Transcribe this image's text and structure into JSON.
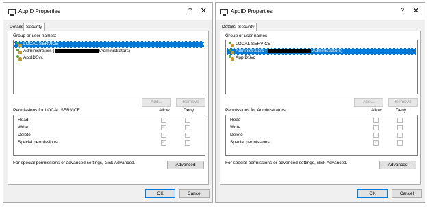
{
  "dialogs": [
    {
      "title": "AppID Properties",
      "help": "?",
      "close": "✕",
      "tabs": {
        "details": "Details",
        "security": "Security"
      },
      "group_label": "Group or user names:",
      "users": [
        {
          "label": "LOCAL SERVICE",
          "selected": true
        },
        {
          "label_prefix": "Administrators (",
          "label_suffix": "\\Administrators)",
          "selected": false
        },
        {
          "label": "AppIDSvc",
          "selected": false
        }
      ],
      "add_label": "Add...",
      "remove_label": "Remove",
      "permissions_for": "Permissions for LOCAL SERVICE",
      "allow_header": "Allow",
      "deny_header": "Deny",
      "permissions": [
        {
          "name": "Read",
          "allow": true,
          "deny": false
        },
        {
          "name": "Write",
          "allow": true,
          "deny": false
        },
        {
          "name": "Delete",
          "allow": true,
          "deny": false
        },
        {
          "name": "Special permissions",
          "allow": true,
          "deny": false
        }
      ],
      "advanced_text": "For special permissions or advanced settings, click Advanced.",
      "advanced_label": "Advanced",
      "ok_label": "OK",
      "cancel_label": "Cancel"
    },
    {
      "title": "AppID Properties",
      "help": "?",
      "close": "✕",
      "tabs": {
        "details": "Details",
        "security": "Security"
      },
      "group_label": "Group or user names:",
      "users": [
        {
          "label": "LOCAL SERVICE",
          "selected": false
        },
        {
          "label_prefix": "Administrators (",
          "label_suffix": "\\Administrators)",
          "selected": true
        },
        {
          "label": "AppIDSvc",
          "selected": false
        }
      ],
      "add_label": "Add...",
      "remove_label": "Remove",
      "permissions_for": "Permissions for Administrators",
      "allow_header": "Allow",
      "deny_header": "Deny",
      "permissions": [
        {
          "name": "Read",
          "allow": false,
          "deny": false
        },
        {
          "name": "Write",
          "allow": false,
          "deny": false
        },
        {
          "name": "Delete",
          "allow": false,
          "deny": false
        },
        {
          "name": "Special permissions",
          "allow": true,
          "deny": false
        }
      ],
      "advanced_text": "For special permissions or advanced settings, click Advanced.",
      "advanced_label": "Advanced",
      "ok_label": "OK",
      "cancel_label": "Cancel"
    }
  ]
}
